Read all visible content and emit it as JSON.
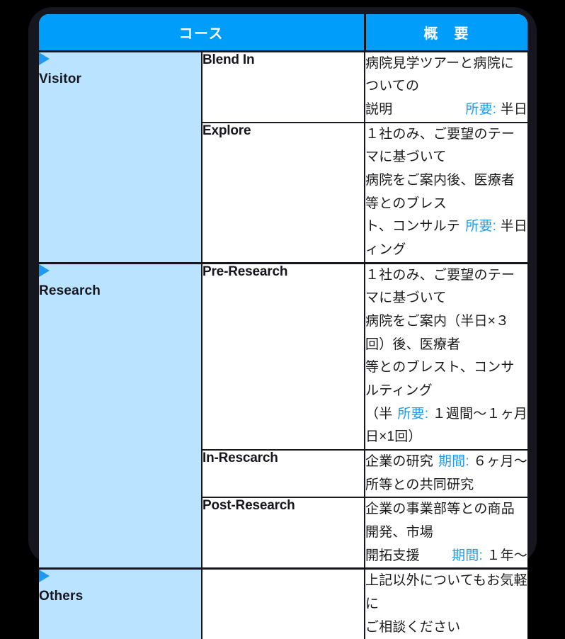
{
  "theme": {
    "page_bg": "#000000",
    "card_bg": "#16161f",
    "header_blue": "#009dfb",
    "group_blue": "#b9e3fe",
    "accent_blue": "#1e9bf0",
    "text_dark": "#16161f",
    "table_bg": "#ffffff"
  },
  "table": {
    "headers": {
      "course": "コース",
      "summary": "概　要"
    },
    "groups": [
      {
        "id": "visitor",
        "label": "Visitor",
        "marker": "triangle-right-icon",
        "rows": [
          {
            "course": "Blend In",
            "lines": [
              "病院見学ツアーと病院についての",
              "説明"
            ],
            "meta_label": "所要:",
            "meta_value": "半日"
          },
          {
            "course": "Explore",
            "lines": [
              "１社のみ、ご要望のテーマに基づいて",
              "病院をご案内後、医療者等とのブレス",
              "ト、コンサルティング"
            ],
            "meta_label": "所要:",
            "meta_value": "半日"
          }
        ]
      },
      {
        "id": "research",
        "label": "Research",
        "marker": "triangle-right-icon",
        "rows": [
          {
            "course": "Pre-Research",
            "lines": [
              "１社のみ、ご要望のテーマに基づいて",
              "病院をご案内（半日×３回）後、医療者",
              "等とのブレスト、コンサルティング",
              "（半日×1回）"
            ],
            "meta_label": "所要:",
            "meta_value": "１週間〜１ヶ月"
          },
          {
            "course": "In-Rescarch",
            "lines": [
              "企業の研究所等との共同研究"
            ],
            "meta_label": "期間:",
            "meta_value": "６ヶ月〜"
          },
          {
            "course": "Post-Research",
            "lines": [
              "企業の事業部等との商品開発、市場",
              "開拓支援"
            ],
            "meta_label": "期間:",
            "meta_value": "１年〜"
          }
        ]
      },
      {
        "id": "others",
        "label": "Others",
        "marker": "triangle-right-icon",
        "rows": [
          {
            "course": "",
            "lines": [
              "上記以外についてもお気軽に",
              "ご相談ください"
            ],
            "meta_label": "",
            "meta_value": ""
          }
        ]
      }
    ]
  }
}
